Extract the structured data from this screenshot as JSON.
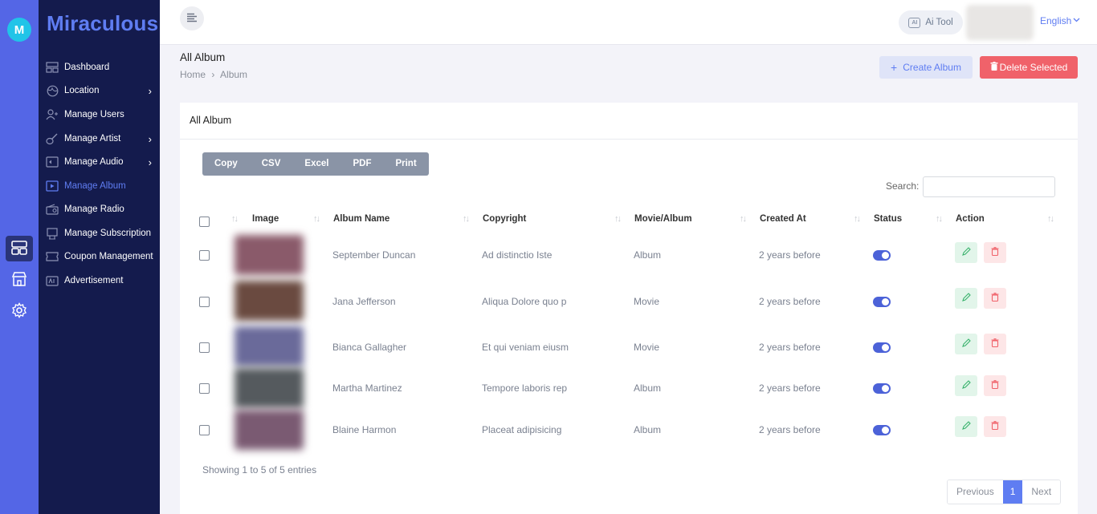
{
  "app": {
    "brand": "Miraculous",
    "logo_letter": "M"
  },
  "rail": {
    "items": [
      {
        "icon": "dashboard-grid-icon",
        "active": true
      },
      {
        "icon": "store-icon",
        "active": false
      },
      {
        "icon": "gear-icon",
        "active": false
      }
    ]
  },
  "sidebar": {
    "items": [
      {
        "label": "Dashboard",
        "icon": "dashboard-icon",
        "has_children": false,
        "active": false
      },
      {
        "label": "Location",
        "icon": "globe-icon",
        "has_children": true,
        "active": false
      },
      {
        "label": "Manage Users",
        "icon": "users-icon",
        "has_children": false,
        "active": false
      },
      {
        "label": "Manage Artist",
        "icon": "guitar-icon",
        "has_children": true,
        "active": false
      },
      {
        "label": "Manage Audio",
        "icon": "speaker-icon",
        "has_children": true,
        "active": false
      },
      {
        "label": "Manage Album",
        "icon": "album-play-icon",
        "has_children": false,
        "active": true
      },
      {
        "label": "Manage Radio",
        "icon": "radio-icon",
        "has_children": false,
        "active": false
      },
      {
        "label": "Manage Subscription",
        "icon": "subscription-icon",
        "has_children": false,
        "active": false
      },
      {
        "label": "Coupon Management",
        "icon": "coupon-icon",
        "has_children": false,
        "active": false
      },
      {
        "label": "Advertisement",
        "icon": "ad-icon",
        "has_children": false,
        "active": false
      }
    ]
  },
  "topbar": {
    "ai_tool_label": "Ai Tool",
    "ai_tool_badge": "AI",
    "language": "English"
  },
  "page": {
    "title": "All Album",
    "breadcrumb": [
      "Home",
      "Album"
    ],
    "create_label": "Create Album",
    "delete_selected_label": "Delete Selected"
  },
  "card": {
    "title": "All Album",
    "export_buttons": [
      "Copy",
      "CSV",
      "Excel",
      "PDF",
      "Print"
    ],
    "search_label": "Search:",
    "search_value": "",
    "columns": [
      "Image",
      "Album Name",
      "Copyright",
      "Movie/Album",
      "Created At",
      "Status",
      "Action"
    ],
    "rows": [
      {
        "name": "September Duncan",
        "copyright": "Ad distinctio Iste",
        "type": "Album",
        "created": "2 years before",
        "status": true,
        "thumb_color": "#8a5a6a"
      },
      {
        "name": "Jana Jefferson",
        "copyright": "Aliqua Dolore quo p",
        "type": "Movie",
        "created": "2 years before",
        "status": true,
        "thumb_color": "#6a4a40"
      },
      {
        "name": "Bianca Gallagher",
        "copyright": "Et qui veniam eiusm",
        "type": "Movie",
        "created": "2 years before",
        "status": true,
        "thumb_color": "#6a6a9a"
      },
      {
        "name": "Martha Martinez",
        "copyright": "Tempore laboris rep",
        "type": "Album",
        "created": "2 years before",
        "status": true,
        "thumb_color": "#555a5e"
      },
      {
        "name": "Blaine Harmon",
        "copyright": "Placeat adipisicing",
        "type": "Album",
        "created": "2 years before",
        "status": true,
        "thumb_color": "#7a5a72"
      }
    ],
    "showing_text": "Showing 1 to 5 of 5 entries",
    "pager": {
      "prev": "Previous",
      "current": "1",
      "next": "Next"
    }
  },
  "colors": {
    "rail": "#5466e6",
    "sidebar": "#141b4d",
    "accent": "#5f7df2",
    "danger": "#f0626a",
    "toggle_on": "#4c62d8"
  }
}
